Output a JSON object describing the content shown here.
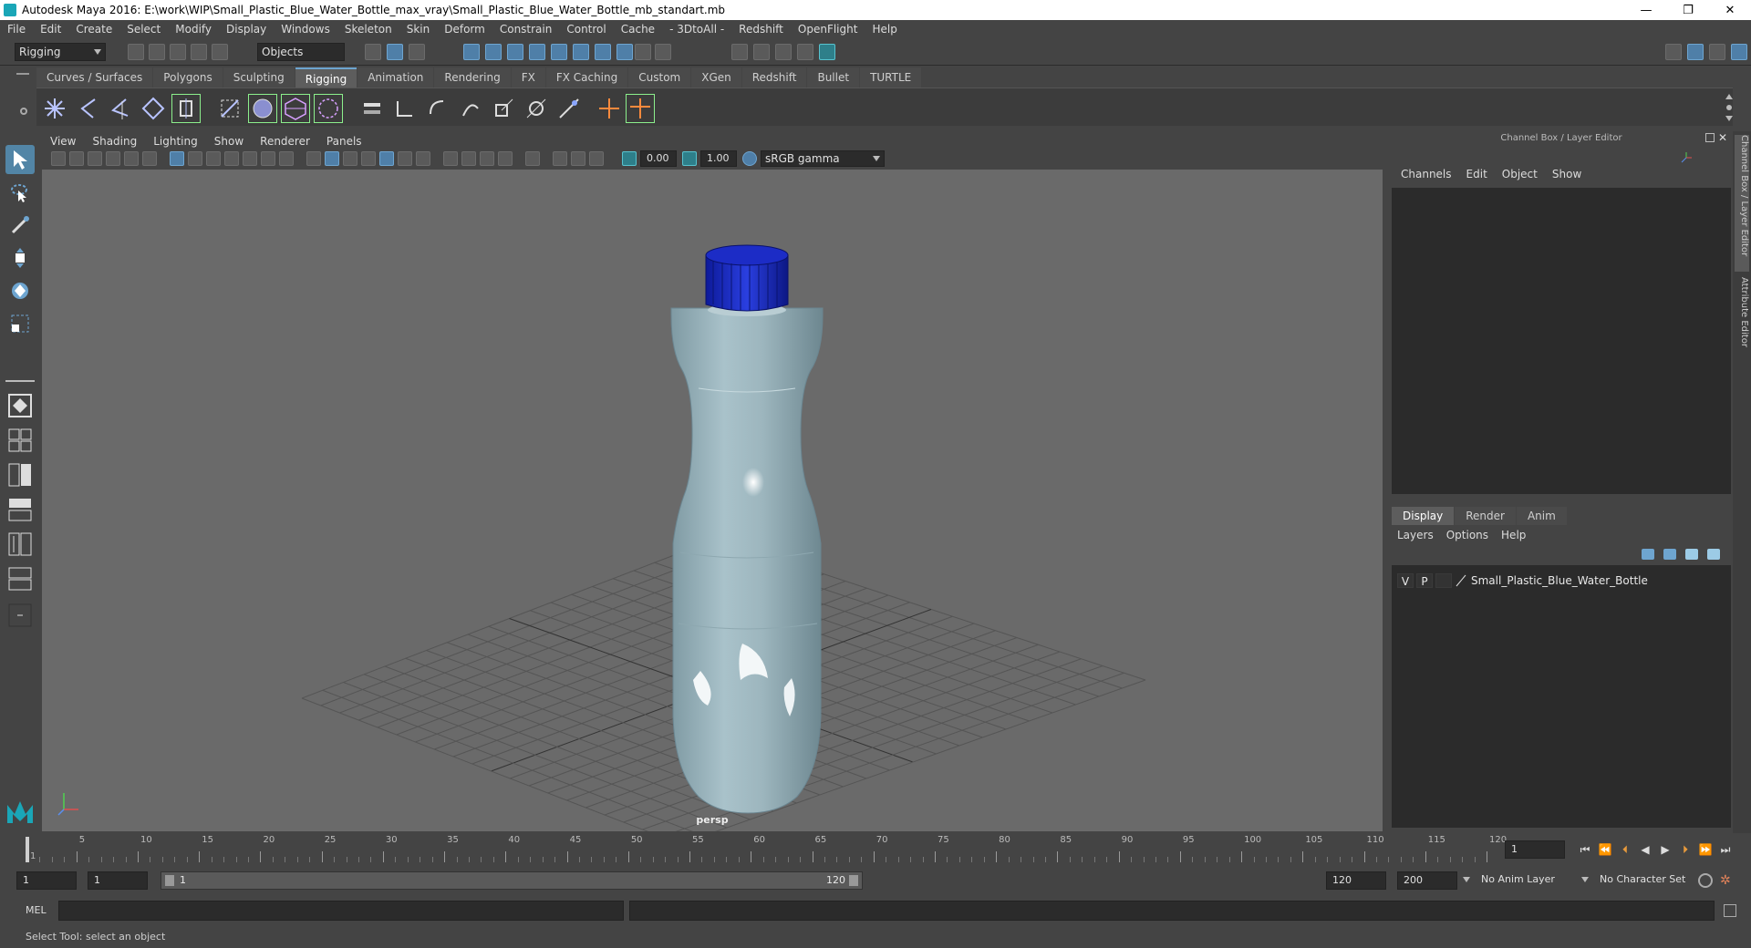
{
  "window": {
    "title": "Autodesk Maya 2016: E:\\work\\WIP\\Small_Plastic_Blue_Water_Bottle_max_vray\\Small_Plastic_Blue_Water_Bottle_mb_standart.mb",
    "minimize": "—",
    "restore": "❐",
    "close": "✕"
  },
  "menubar": [
    "File",
    "Edit",
    "Create",
    "Select",
    "Modify",
    "Display",
    "Windows",
    "Skeleton",
    "Skin",
    "Deform",
    "Constrain",
    "Control",
    "Cache",
    "- 3DtoAll -",
    "Redshift",
    "OpenFlight",
    "Help"
  ],
  "statusline": {
    "mode": "Rigging",
    "selection_mode": "Objects"
  },
  "shelf": {
    "tabs": [
      "Curves / Surfaces",
      "Polygons",
      "Sculpting",
      "Rigging",
      "Animation",
      "Rendering",
      "FX",
      "FX Caching",
      "Custom",
      "XGen",
      "Redshift",
      "Bullet",
      "TURTLE"
    ],
    "active_tab": "Rigging"
  },
  "viewport": {
    "menu": [
      "View",
      "Shading",
      "Lighting",
      "Show",
      "Renderer",
      "Panels"
    ],
    "exposure": "0.00",
    "gamma": "1.00",
    "color_space": "sRGB gamma",
    "camera": "persp"
  },
  "channel_box": {
    "title": "Channel Box / Layer Editor",
    "menu": [
      "Channels",
      "Edit",
      "Object",
      "Show"
    ]
  },
  "layer_editor": {
    "tabs": [
      "Display",
      "Render",
      "Anim"
    ],
    "active_tab": "Display",
    "menu": [
      "Layers",
      "Options",
      "Help"
    ],
    "layers": [
      {
        "v": "V",
        "p": "P",
        "name": "Small_Plastic_Blue_Water_Bottle"
      }
    ]
  },
  "side_tabs": {
    "channel_box": "Channel Box / Layer Editor",
    "attribute_editor": "Attribute Editor"
  },
  "timeline": {
    "tick_labels": [
      "1",
      "5",
      "10",
      "15",
      "20",
      "25",
      "30",
      "35",
      "40",
      "45",
      "50",
      "55",
      "60",
      "65",
      "70",
      "75",
      "80",
      "85",
      "90",
      "95",
      "100",
      "105",
      "110",
      "115",
      "120"
    ],
    "current_frame": "1"
  },
  "range": {
    "start": "1",
    "playback_start": "1",
    "range_start_label": "1",
    "range_end_label": "120",
    "playback_end": "120",
    "end": "200",
    "anim_layer": "No Anim Layer",
    "character_set": "No Character Set"
  },
  "command_line": {
    "label": "MEL"
  },
  "help_line": "Select Tool: select an object",
  "colors": {
    "accent": "#5285a6",
    "bottle_cap": "#1b2fc4",
    "viewport_bg": "#6a6a6a"
  }
}
